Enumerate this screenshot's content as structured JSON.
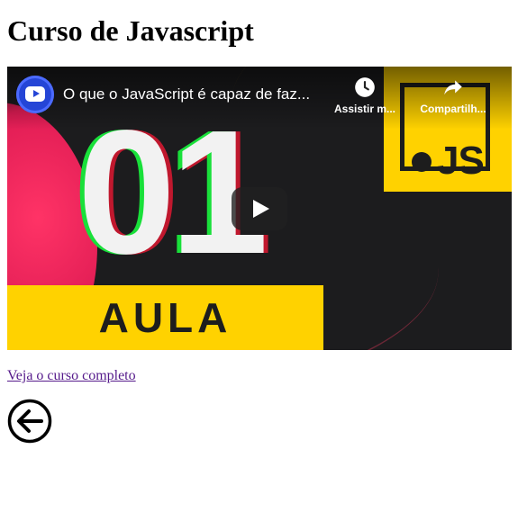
{
  "page": {
    "heading": "Curso de Javascript",
    "course_link_text": "Veja o curso completo"
  },
  "video": {
    "title": "O que o JavaScript é capaz de faz...",
    "watch_later_label": "Assistir m...",
    "share_label": "Compartilh...",
    "thumbnail": {
      "number": "01",
      "band_text": "AULA",
      "badge_text": "JS"
    },
    "colors": {
      "accent_yellow": "#ffd200",
      "channel_blue": "#2545d6",
      "background": "#1c1c1e"
    },
    "icons": {
      "channel": "youtube-channel-avatar-icon",
      "watch_later": "clock-icon",
      "share": "share-arrow-icon",
      "play": "play-icon"
    }
  },
  "back": {
    "icon": "arrow-left-circle-icon"
  },
  "colors": {
    "visited_link": "#551a8b"
  }
}
